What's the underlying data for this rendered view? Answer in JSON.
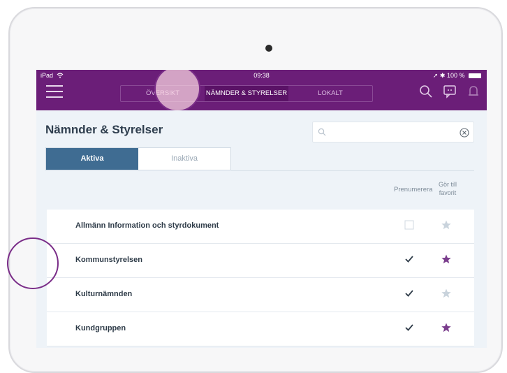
{
  "status": {
    "device": "iPad",
    "time": "09:38",
    "battery": "100 %"
  },
  "nav": {
    "tabs": [
      {
        "label": "ÖVERSIKT",
        "active": false
      },
      {
        "label": "NÄMNDER & STYRELSER",
        "active": true
      },
      {
        "label": "LOKALT",
        "active": false
      }
    ]
  },
  "page": {
    "title": "Nämnder & Styrelser",
    "search_placeholder": "",
    "tabs": [
      {
        "label": "Aktiva",
        "active": true
      },
      {
        "label": "Inaktiva",
        "active": false
      }
    ],
    "columns": {
      "subscribe": "Prenumerera",
      "favorite": "Gör till favorit"
    },
    "rows": [
      {
        "name": "Allmänn Information och styrdokument",
        "subscribed": false,
        "favorite": false
      },
      {
        "name": "Kommunstyrelsen",
        "subscribed": true,
        "favorite": true
      },
      {
        "name": "Kulturnämnden",
        "subscribed": true,
        "favorite": false
      },
      {
        "name": "Kundgruppen",
        "subscribed": true,
        "favorite": true
      }
    ]
  },
  "colors": {
    "brand": "#6b1e78",
    "tab_active": "#3f6c92",
    "star_on": "#7a3d8c",
    "star_off": "#c9d3dc"
  },
  "icons": [
    "wifi-icon",
    "menu-icon",
    "search-icon",
    "chat-icon",
    "bell-icon",
    "clear-icon",
    "checkbox-icon",
    "star-icon"
  ]
}
